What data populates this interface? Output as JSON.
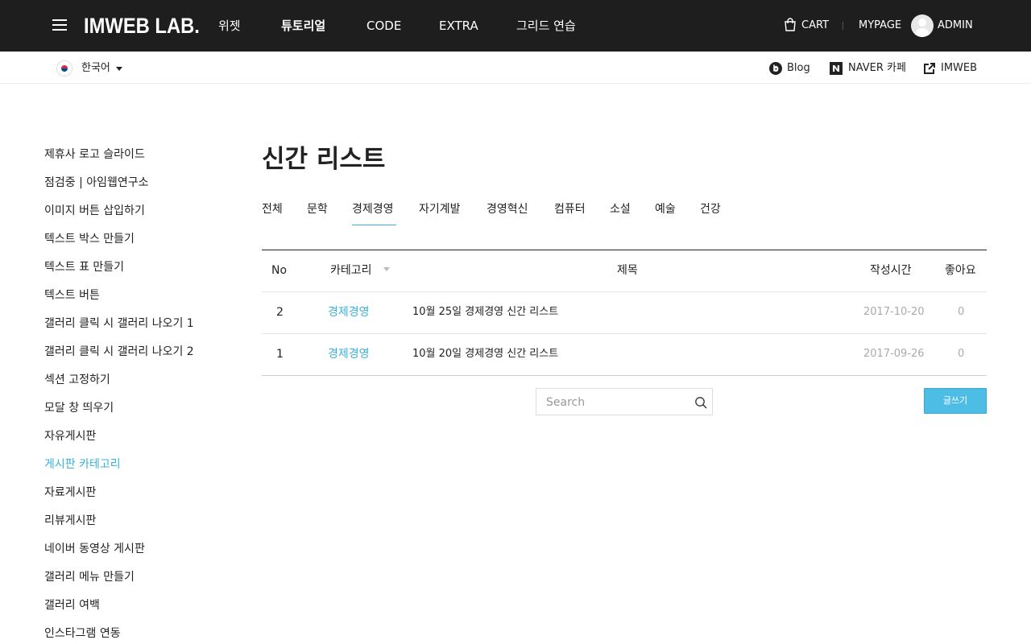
{
  "header": {
    "logo": "IMWEB LAB.",
    "nav": [
      {
        "label": "위젯",
        "active": false
      },
      {
        "label": "튜토리얼",
        "active": true
      },
      {
        "label": "CODE",
        "active": false
      },
      {
        "label": "EXTRA",
        "active": false
      },
      {
        "label": "그리드 연습",
        "active": false
      }
    ],
    "cart_label": "CART",
    "mypage_label": "MYPAGE",
    "admin_label": "ADMIN"
  },
  "subbar": {
    "language": "한국어",
    "links": [
      {
        "label": "Blog",
        "icon": "blog-icon"
      },
      {
        "label": "NAVER 카페",
        "icon": "naver-icon"
      },
      {
        "label": "IMWEB",
        "icon": "external-link-icon"
      }
    ]
  },
  "sidebar": {
    "items": [
      {
        "label": "제휴사 로고 슬라이드"
      },
      {
        "label": "점검중 | 아임웹연구소"
      },
      {
        "label": "이미지 버튼 삽입하기"
      },
      {
        "label": "텍스트 박스 만들기"
      },
      {
        "label": "텍스트 표 만들기"
      },
      {
        "label": "텍스트 버튼"
      },
      {
        "label": "갤러리 클릭 시 갤러리 나오기 1"
      },
      {
        "label": "갤러리 클릭 시 갤러리 나오기 2"
      },
      {
        "label": "섹션 고정하기"
      },
      {
        "label": "모달 창 띄우기"
      },
      {
        "label": "자유게시판"
      },
      {
        "label": "게시판 카테고리",
        "active": true
      },
      {
        "label": "자료게시판"
      },
      {
        "label": "리뷰게시판"
      },
      {
        "label": "네이버 동영상 게시판"
      },
      {
        "label": "갤러리 메뉴 만들기"
      },
      {
        "label": "갤러리 여백"
      },
      {
        "label": "인스타그램 연동"
      }
    ]
  },
  "main": {
    "title": "신간 리스트",
    "tabs": [
      {
        "label": "전체"
      },
      {
        "label": "문학"
      },
      {
        "label": "경제경영",
        "active": true
      },
      {
        "label": "자기계발"
      },
      {
        "label": "경영혁신"
      },
      {
        "label": "컴퓨터"
      },
      {
        "label": "소설"
      },
      {
        "label": "예술"
      },
      {
        "label": "건강"
      }
    ],
    "table": {
      "headers": {
        "no": "No",
        "category": "카테고리",
        "title": "제목",
        "date": "작성시간",
        "likes": "좋아요"
      },
      "rows": [
        {
          "no": "2",
          "category": "경제경영",
          "title": "10월 25일 경제경영 신간 리스트",
          "date": "2017-10-20",
          "likes": "0"
        },
        {
          "no": "1",
          "category": "경제경영",
          "title": "10월 20일 경제경영 신간 리스트",
          "date": "2017-09-26",
          "likes": "0"
        }
      ]
    },
    "search": {
      "placeholder": "Search",
      "value": ""
    },
    "write_label": "글쓰기"
  },
  "colors": {
    "header_bg": "#1e1e1e",
    "accent": "#39b1dd",
    "write_button": "#4dbde6"
  }
}
